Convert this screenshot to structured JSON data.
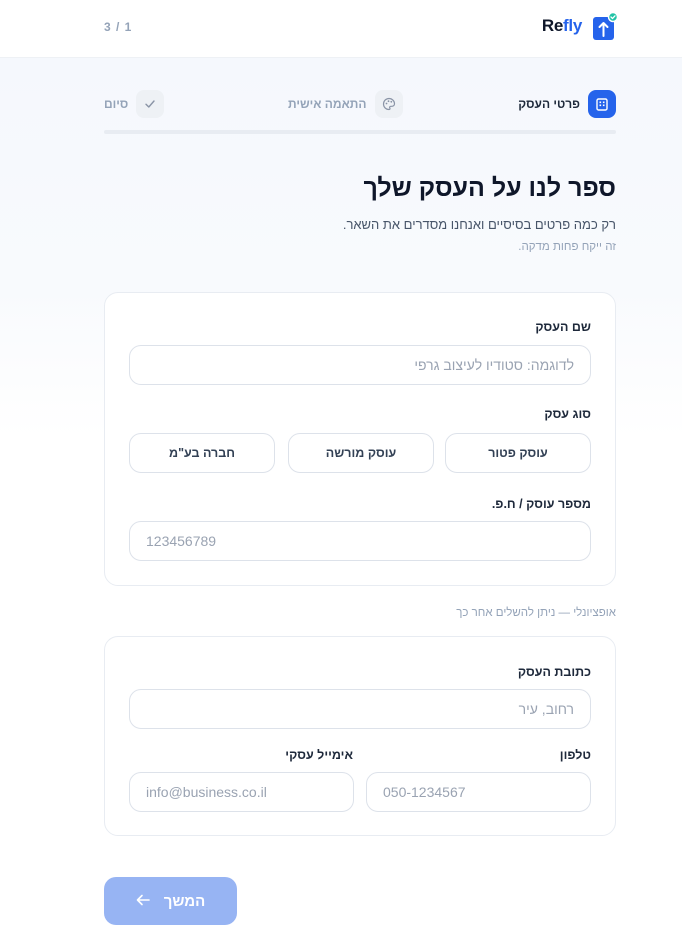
{
  "header": {
    "counter": "3 / 1",
    "brand_prefix": "Re",
    "brand_suffix": "fly"
  },
  "stepper": {
    "steps": [
      {
        "label": "פרטי העסק",
        "icon": "building-icon",
        "state": "active"
      },
      {
        "label": "התאמה אישית",
        "icon": "palette-icon",
        "state": "pending"
      },
      {
        "label": "סיום",
        "icon": "check-icon",
        "state": "pending"
      }
    ],
    "progress": 0
  },
  "intro": {
    "title": "ספר לנו על העסק שלך",
    "subtitle": "רק כמה פרטים בסיסיים ואנחנו מסדרים את השאר.",
    "hint": "זה ייקח פחות מדקה."
  },
  "business": {
    "name_label": "שם העסק",
    "name_placeholder": "לדוגמה: סטודיו לעיצוב גרפי",
    "name_value": "",
    "type_label": "סוג עסק",
    "type_options": [
      "עוסק פטור",
      "עוסק מורשה",
      "חברה בע\"מ"
    ],
    "id_label": "מספר עוסק / ח.פ.",
    "id_placeholder": "123456789",
    "id_value": ""
  },
  "optional": {
    "note": "אופציונלי — ניתן להשלים אחר כך",
    "address_label": "כתובת העסק",
    "address_placeholder": "רחוב, עיר",
    "phone_label": "טלפון",
    "phone_placeholder": "050-1234567",
    "email_label": "אימייל עסקי",
    "email_placeholder": "info@business.co.il"
  },
  "actions": {
    "continue_label": "המשך"
  },
  "colors": {
    "accent": "#2563eb",
    "button_disabled": "#97b4f3",
    "muted": "#94a3b8"
  }
}
